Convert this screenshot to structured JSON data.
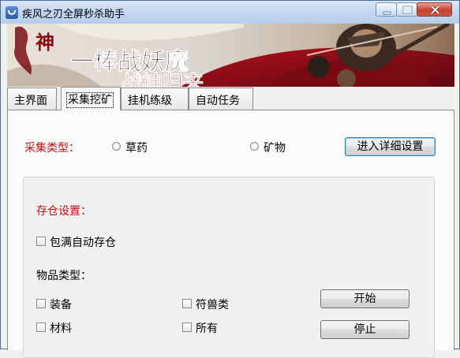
{
  "window": {
    "title": "疾风之刃全屏秒杀助手",
    "app_icon": "app-logo-icon",
    "controls": [
      "minimize-icon",
      "maximize-icon",
      "close-icon"
    ]
  },
  "banner": {
    "logo_text": "神",
    "slogan": "一棒战妖魔",
    "subtitle": "战神归来"
  },
  "tabs": [
    {
      "label": "主界面",
      "active": false
    },
    {
      "label": "采集挖矿",
      "active": true
    },
    {
      "label": "挂机练级",
      "active": false
    },
    {
      "label": "自动任务",
      "active": false
    }
  ],
  "gather": {
    "type_label": "采集类型：",
    "option_herb": "草药",
    "option_ore": "矿物",
    "detail_button": "进入详细设置"
  },
  "storage": {
    "title": "存仓设置：",
    "auto_store_label": "包满自动存仓",
    "item_type_label": "物品类型：",
    "items": [
      "装备",
      "符兽类",
      "材料",
      "所有"
    ]
  },
  "actions": {
    "start": "开始",
    "stop": "停止"
  },
  "colors": {
    "accent_red": "#c01010",
    "titlebar": "#c3d8f1",
    "close_red": "#c5412c"
  }
}
